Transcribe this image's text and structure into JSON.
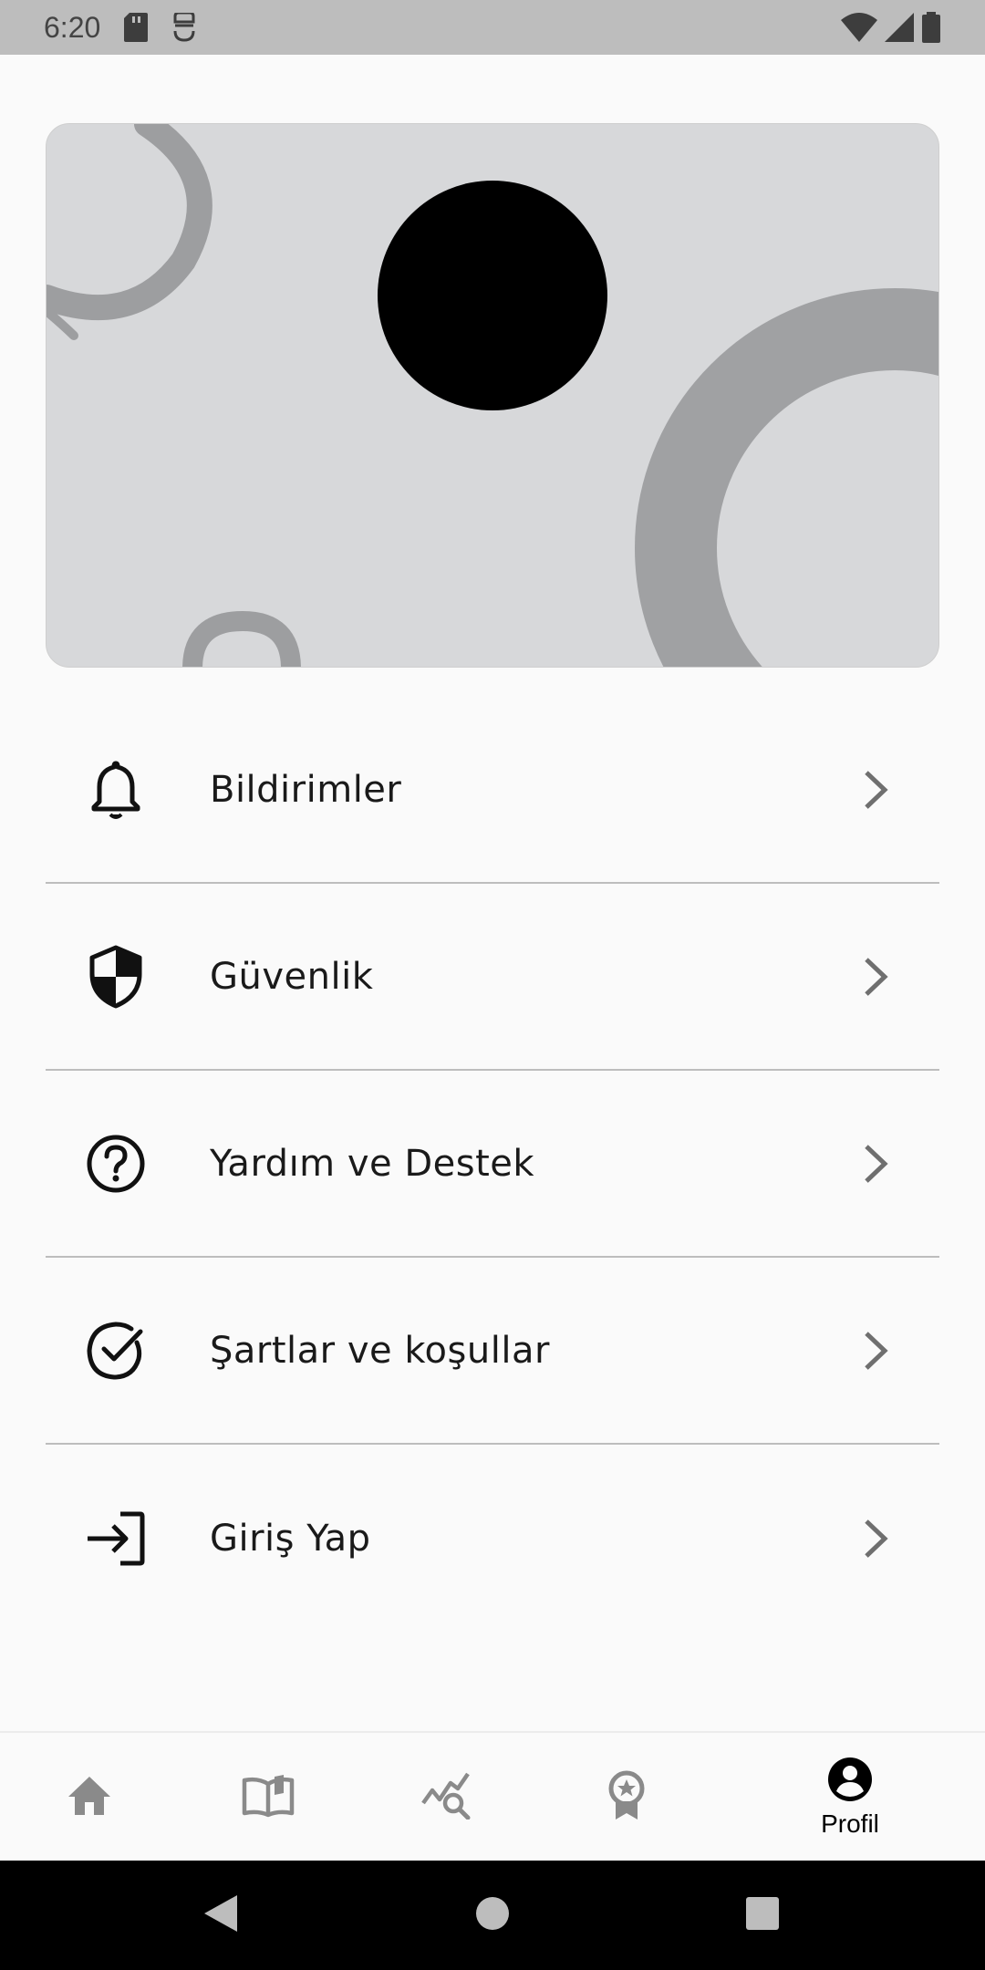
{
  "status_bar": {
    "time": "6:20",
    "icons_left": [
      "sd-card-icon",
      "debug-icon"
    ],
    "icons_right": [
      "wifi-icon",
      "signal-icon",
      "battery-icon"
    ]
  },
  "header": {
    "avatar": "avatar"
  },
  "menu": {
    "items": [
      {
        "label": "Bildirimler",
        "icon": "bell-icon"
      },
      {
        "label": "Güvenlik",
        "icon": "shield-icon"
      },
      {
        "label": "Yardım ve Destek",
        "icon": "help-circle-icon"
      },
      {
        "label": "Şartlar ve koşullar",
        "icon": "check-circle-icon"
      },
      {
        "label": "Giriş Yap",
        "icon": "login-icon"
      }
    ]
  },
  "bottom_nav": {
    "items": [
      {
        "icon": "home-icon",
        "label": ""
      },
      {
        "icon": "book-icon",
        "label": ""
      },
      {
        "icon": "chart-search-icon",
        "label": ""
      },
      {
        "icon": "award-icon",
        "label": ""
      },
      {
        "icon": "profile-icon",
        "label": "Profil",
        "active": true
      }
    ]
  },
  "colors": {
    "status_bar": "#bdbdbd",
    "header_card": "#d7d8da",
    "decor": "#9d9ea0",
    "inactive_nav": "#8a8a8a",
    "active_nav": "#000000"
  }
}
